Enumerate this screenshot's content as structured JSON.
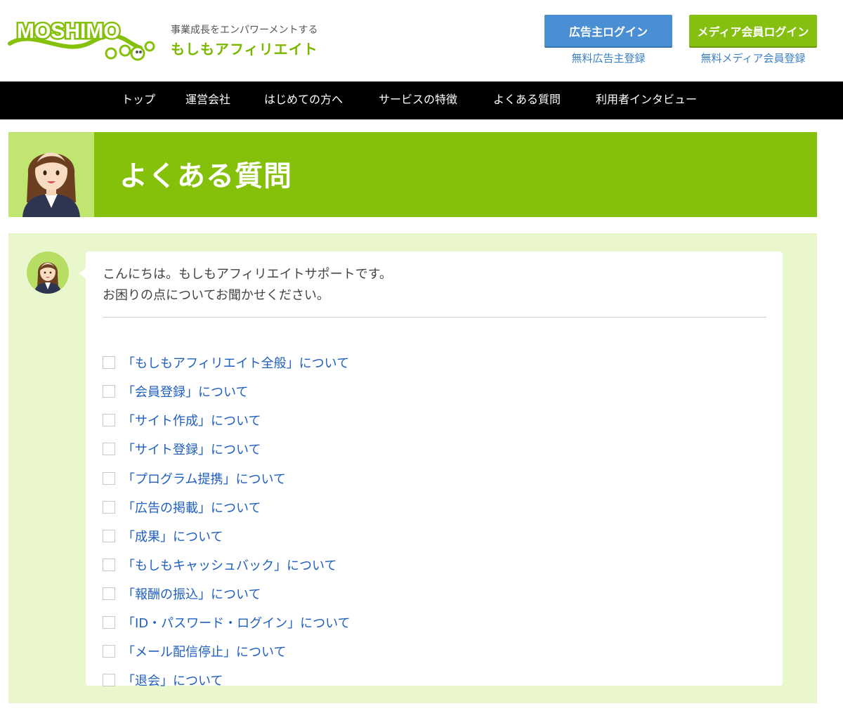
{
  "header": {
    "logo_text": "MOSHIMO",
    "tagline": "事業成長をエンパワーメントする",
    "brand": "もしもアフィリエイト",
    "advertiser_login": "広告主ログイン",
    "advertiser_register": "無料広告主登録",
    "media_login": "メディア会員ログイン",
    "media_register": "無料メディア会員登録"
  },
  "nav": {
    "items": [
      {
        "label": "トップ"
      },
      {
        "label": "運営会社"
      },
      {
        "label": "はじめての方へ"
      },
      {
        "label": "サービスの特徴"
      },
      {
        "label": "よくある質問"
      },
      {
        "label": "利用者インタビュー"
      }
    ]
  },
  "banner": {
    "title": "よくある質問"
  },
  "support": {
    "greeting_line1": "こんにちは。もしもアフィリエイトサポートです。",
    "greeting_line2": "お困りの点についてお聞かせください。",
    "topics": [
      {
        "label": "「もしもアフィリエイト全般」について"
      },
      {
        "label": "「会員登録」について"
      },
      {
        "label": "「サイト作成」について"
      },
      {
        "label": "「サイト登録」について"
      },
      {
        "label": "「プログラム提携」について"
      },
      {
        "label": "「広告の掲載」について"
      },
      {
        "label": "「成果」について"
      },
      {
        "label": "「もしもキャッシュバック」について"
      },
      {
        "label": "「報酬の振込」について"
      },
      {
        "label": "「ID・パスワード・ログイン」について"
      },
      {
        "label": "「メール配信停止」について"
      },
      {
        "label": "「退会」について"
      }
    ]
  },
  "colors": {
    "brand_green": "#85c10a",
    "advertiser_blue": "#4a8ed4",
    "link_blue": "#1f5fbf",
    "nav_bg": "#000000",
    "faq_bg": "#eaf6cc"
  }
}
